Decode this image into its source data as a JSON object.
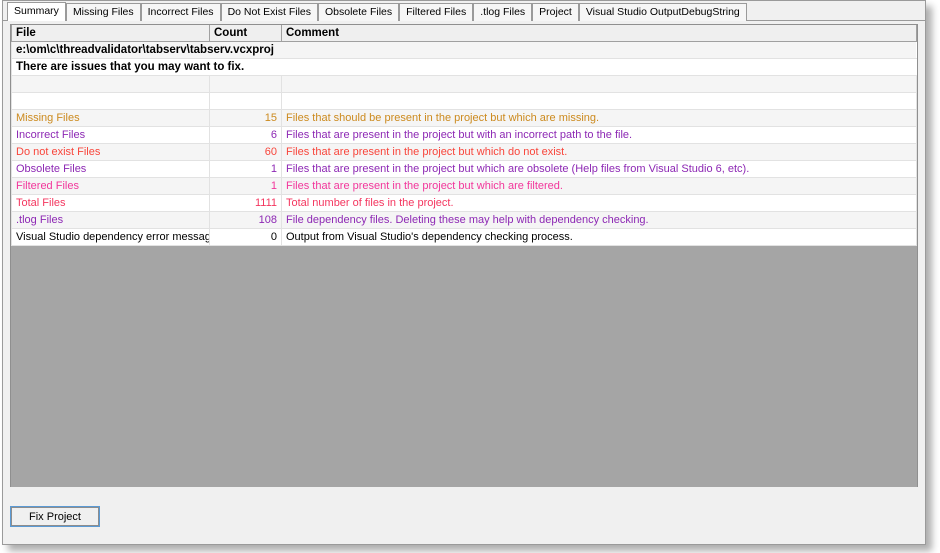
{
  "tabs": [
    {
      "label": "Summary",
      "active": true
    },
    {
      "label": "Missing Files",
      "active": false
    },
    {
      "label": "Incorrect Files",
      "active": false
    },
    {
      "label": "Do Not Exist Files",
      "active": false
    },
    {
      "label": "Obsolete Files",
      "active": false
    },
    {
      "label": "Filtered Files",
      "active": false
    },
    {
      "label": ".tlog Files",
      "active": false
    },
    {
      "label": "Project",
      "active": false
    },
    {
      "label": "Visual Studio OutputDebugString",
      "active": false
    }
  ],
  "grid": {
    "columns": [
      {
        "label": "File"
      },
      {
        "label": "Count"
      },
      {
        "label": "Comment"
      }
    ],
    "headline_rows": [
      {
        "text": "e:\\om\\c\\threadvalidator\\tabserv\\tabserv.vcxproj"
      },
      {
        "text": "There are issues that you may want to fix."
      }
    ],
    "rows": [
      {
        "file": "Missing Files",
        "count": "15",
        "comment": "Files that should be present in the project but which are missing.",
        "color": "#cc8a1e"
      },
      {
        "file": "Incorrect Files",
        "count": "6",
        "comment": "Files that are present in the project but with an incorrect path to the file.",
        "color": "#8d28b4"
      },
      {
        "file": "Do not exist Files",
        "count": "60",
        "comment": "Files that are present in the project but which do not exist.",
        "color": "#f8453b"
      },
      {
        "file": "Obsolete Files",
        "count": "1",
        "comment": "Files that are present in the project but which are obsolete (Help files from Visual Studio 6, etc).",
        "color": "#8d28b4"
      },
      {
        "file": "Filtered Files",
        "count": "1",
        "comment": "Files that are present in the project but which are filtered.",
        "color": "#f2369b"
      },
      {
        "file": "Total Files",
        "count": "1111",
        "comment": "Total number of files in the project.",
        "color": "#f4365f"
      },
      {
        "file": ".tlog Files",
        "count": "108",
        "comment": "File dependency files. Deleting these may help with dependency checking.",
        "color": "#8d28b4"
      },
      {
        "file": "Visual Studio dependency error messages",
        "count": "0",
        "comment": "Output from Visual Studio's dependency checking process.",
        "color": "#000000"
      }
    ]
  },
  "footer": {
    "fix_project_label": "Fix Project"
  },
  "colors": {
    "empty_area": "#a5a5a5",
    "chrome": "#f0f0f0",
    "focus_outline": "#5b9ad4"
  }
}
